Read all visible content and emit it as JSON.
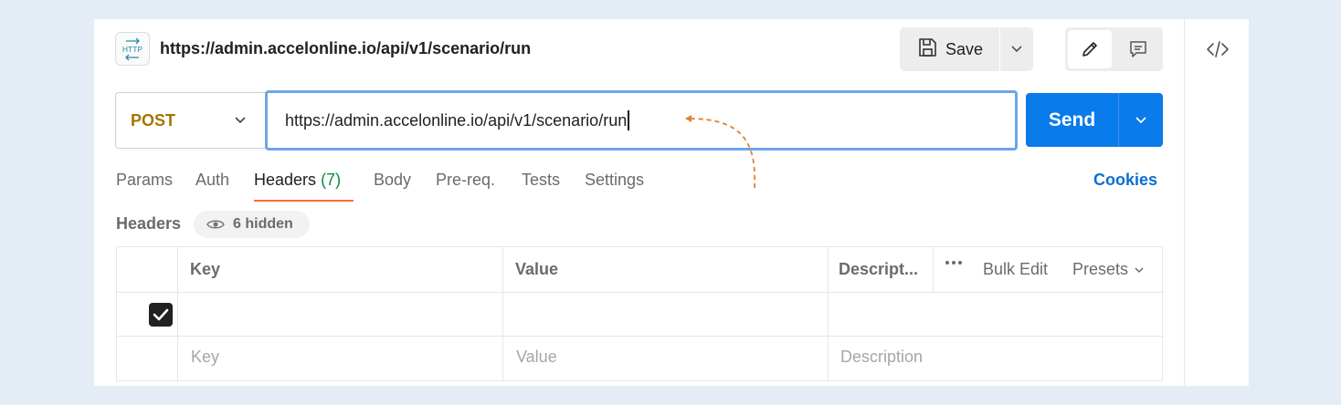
{
  "request": {
    "badge_text": "HTTP",
    "title": "https://admin.accelonline.io/api/v1/scenario/run",
    "method": "POST",
    "url_value": "https://admin.accelonline.io/api/v1/scenario/run"
  },
  "toolbar": {
    "save_label": "Save",
    "send_label": "Send"
  },
  "tabs": [
    {
      "label": "Params"
    },
    {
      "label": "Auth"
    },
    {
      "label": "Headers",
      "count": "(7)",
      "active": true
    },
    {
      "label": "Body"
    },
    {
      "label": "Pre-req."
    },
    {
      "label": "Tests"
    },
    {
      "label": "Settings"
    }
  ],
  "cookies_label": "Cookies",
  "headers_section": {
    "title": "Headers",
    "hidden_label": "6 hidden"
  },
  "table": {
    "columns": [
      "Key",
      "Value",
      "Descript..."
    ],
    "bulk_edit_label": "Bulk Edit",
    "presets_label": "Presets",
    "rows": [
      {
        "checked": true,
        "key": "",
        "value": "",
        "description": ""
      }
    ],
    "placeholders": {
      "key": "Key",
      "value": "Value",
      "description": "Description"
    }
  },
  "colors": {
    "accent": "#0a7bea",
    "method": "#a77400",
    "tab_underline": "#ff6c37",
    "annotation_arrow": "#e0822b",
    "link": "#0b6ed0"
  },
  "icons": [
    "http-icon",
    "save-icon",
    "chevron-down-icon",
    "pencil-icon",
    "comment-icon",
    "code-icon",
    "eye-icon",
    "more-icon",
    "check-icon"
  ]
}
